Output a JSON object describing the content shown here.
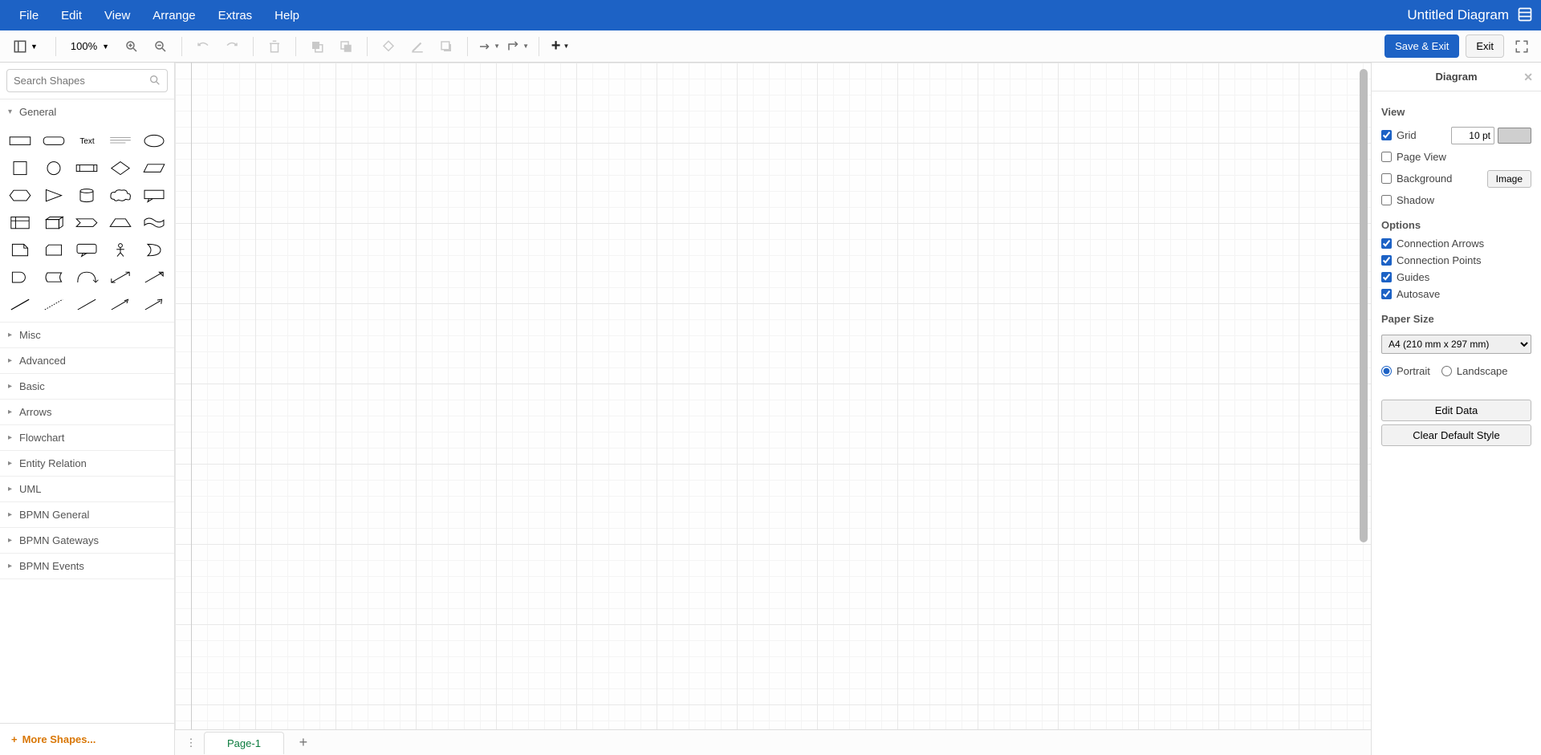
{
  "doc_title": "Untitled Diagram",
  "menubar": [
    "File",
    "Edit",
    "View",
    "Arrange",
    "Extras",
    "Help"
  ],
  "toolbar": {
    "zoom": "100%",
    "save_exit_label": "Save & Exit",
    "exit_label": "Exit"
  },
  "search": {
    "placeholder": "Search Shapes"
  },
  "categories": {
    "expanded": "General",
    "collapsed": [
      "Misc",
      "Advanced",
      "Basic",
      "Arrows",
      "Flowchart",
      "Entity Relation",
      "UML",
      "BPMN General",
      "BPMN Gateways",
      "BPMN Events"
    ]
  },
  "more_shapes_label": "More Shapes...",
  "page_tabs": {
    "active": "Page-1"
  },
  "right_panel": {
    "title": "Diagram",
    "view_label": "View",
    "grid_label": "Grid",
    "grid_checked": true,
    "grid_value": "10 pt",
    "pageview_label": "Page View",
    "pageview_checked": false,
    "background_label": "Background",
    "background_checked": false,
    "image_btn": "Image",
    "shadow_label": "Shadow",
    "shadow_checked": false,
    "options_label": "Options",
    "conn_arrows_label": "Connection Arrows",
    "conn_arrows_checked": true,
    "conn_points_label": "Connection Points",
    "conn_points_checked": true,
    "guides_label": "Guides",
    "guides_checked": true,
    "autosave_label": "Autosave",
    "autosave_checked": true,
    "paper_label": "Paper Size",
    "paper_value": "A4 (210 mm x 297 mm)",
    "portrait_label": "Portrait",
    "landscape_label": "Landscape",
    "orientation": "portrait",
    "edit_data_btn": "Edit Data",
    "clear_style_btn": "Clear Default Style"
  }
}
